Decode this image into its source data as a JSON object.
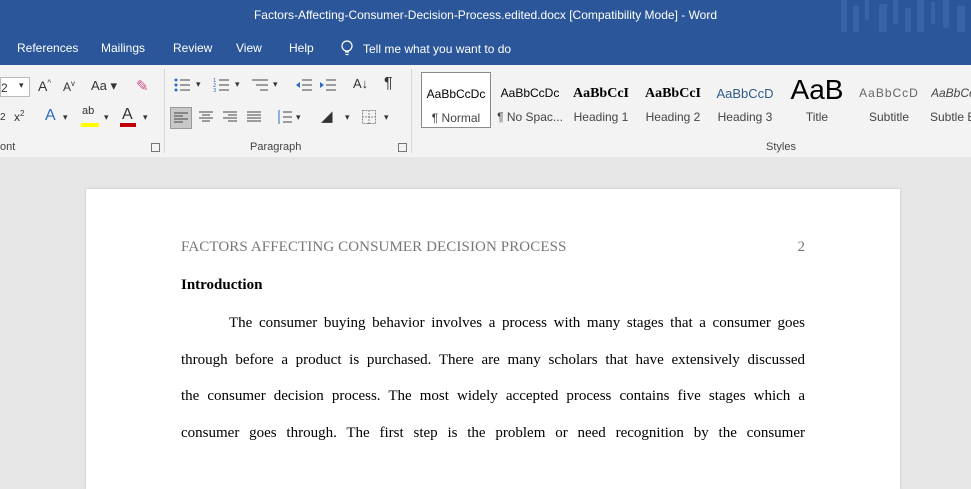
{
  "window": {
    "title": "Factors-Affecting-Consumer-Decision-Process.edited.docx [Compatibility Mode]  -  Word"
  },
  "menu": {
    "items": [
      "References",
      "Mailings",
      "Review",
      "View",
      "Help"
    ],
    "tell_me": "Tell me what you want to do"
  },
  "ribbon": {
    "font": {
      "size_value": "2",
      "group_label": "ont"
    },
    "paragraph": {
      "group_label": "Paragraph"
    },
    "styles": {
      "group_label": "Styles",
      "items": [
        {
          "sample": "AaBbCcDc",
          "name": "¶ Normal"
        },
        {
          "sample": "AaBbCcDc",
          "name": "¶ No Spac..."
        },
        {
          "sample": "AaBbCcI",
          "name": "Heading 1"
        },
        {
          "sample": "AaBbCcI",
          "name": "Heading 2"
        },
        {
          "sample": "AaBbCcD",
          "name": "Heading 3"
        },
        {
          "sample": "AaB",
          "name": "Title"
        },
        {
          "sample": "AaBbCcD",
          "name": "Subtitle"
        },
        {
          "sample": "AaBbCc",
          "name": "Subtle E"
        }
      ]
    },
    "colors": {
      "highlight": "#ffff00",
      "font_color": "#c00000"
    }
  },
  "document": {
    "header": "FACTORS AFFECTING CONSUMER DECISION PROCESS",
    "page_number": "2",
    "heading": "Introduction",
    "lines": [
      "The consumer buying behavior involves a process with many stages that a consumer goes",
      "through before a product is purchased. There are many scholars that have extensively discussed",
      "the consumer decision process. The most widely accepted process contains five stages which a",
      "consumer goes through. The first step is the problem or need recognition by the consumer"
    ]
  },
  "theme": {
    "accent": "#2b579a",
    "ribbon_bg": "#f3f3f3",
    "canvas_bg": "#e6e6e6"
  }
}
